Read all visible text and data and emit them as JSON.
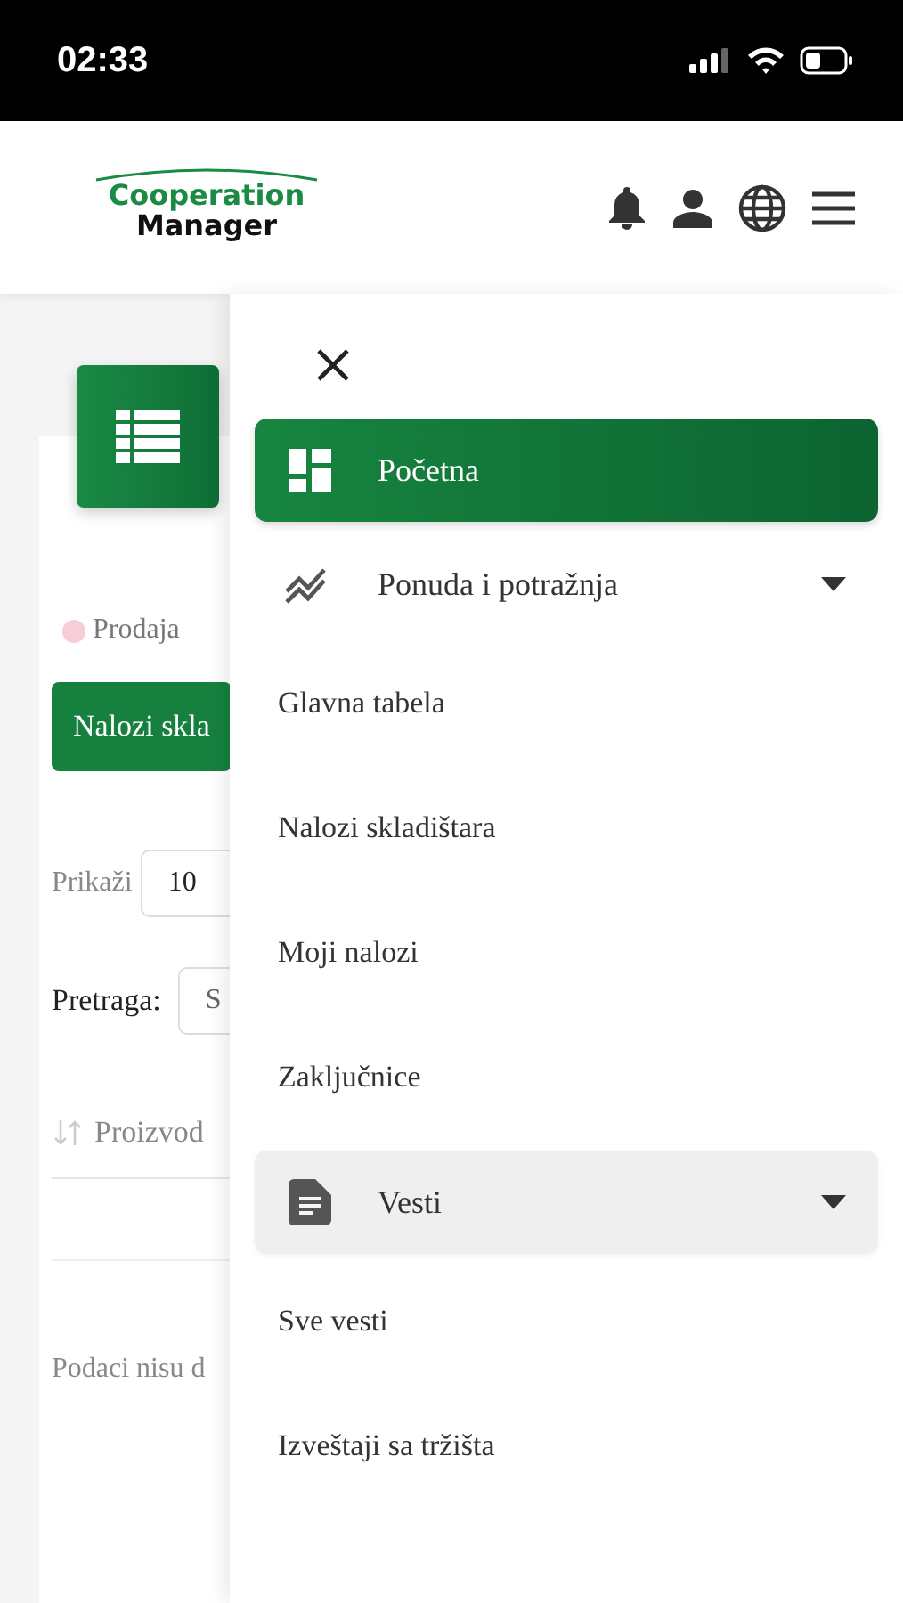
{
  "status_bar": {
    "time": "02:33"
  },
  "header": {
    "logo": {
      "line1": "Cooperation",
      "line2": "Manager"
    }
  },
  "background": {
    "legend": {
      "label": "Prodaja",
      "color": "#f9cdd5"
    },
    "button": "Nalozi skla",
    "show": {
      "label": "Prikaži",
      "value": "10"
    },
    "search": {
      "label": "Pretraga:",
      "placeholder": "S"
    },
    "table": {
      "column": "Proizvod",
      "empty": "Podaci nisu d"
    }
  },
  "menu": [
    {
      "label": "Početna",
      "selected": true,
      "hovered": false
    },
    {
      "label": "Ponuda i potražnja",
      "selected": false,
      "hovered": false,
      "children": [
        {
          "label": "Glavna tabela"
        },
        {
          "label": "Nalozi skladištara"
        },
        {
          "label": "Moji nalozi"
        },
        {
          "label": "Zaključnice"
        }
      ]
    },
    {
      "label": "Vesti",
      "selected": false,
      "hovered": true,
      "children": [
        {
          "label": "Sve vesti"
        },
        {
          "label": "Izveštaji sa tržišta"
        }
      ]
    }
  ]
}
